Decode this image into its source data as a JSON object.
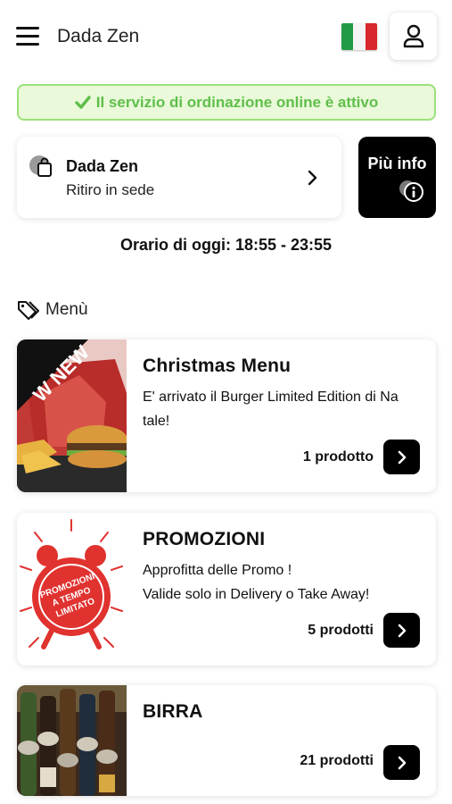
{
  "header": {
    "title": "Dada Zen",
    "menu_icon": "hamburger-menu-icon",
    "language_flag": "italy-flag",
    "user_icon": "user-icon"
  },
  "status_banner": {
    "text": "Il servizio di ordinazione online è attivo",
    "icon": "checkmark-icon",
    "color": "#5fbf4a",
    "background": "#e9f9d9"
  },
  "store": {
    "name": "Dada Zen",
    "mode": "Ritiro in sede",
    "icon": "shopping-bag-icon"
  },
  "info_button": {
    "label": "Più info",
    "icon": "info-icon"
  },
  "hours": "Orario di oggi: 18:55 - 23:55",
  "menu_section": {
    "label": "Menù",
    "icon": "tag-icon"
  },
  "categories": [
    {
      "title": "Christmas Menu",
      "description": "E' arrivato il Burger Limited Edition di Na tale!",
      "count": "1 prodotto",
      "badge": "NEW"
    },
    {
      "title": "PROMOZIONI",
      "description": "Approfitta delle Promo !\nValide solo in Delivery o Take Away!",
      "count": "5 prodotti",
      "image_text": "PROMOZIONI A TEMPO LIMITATO"
    },
    {
      "title": "BIRRA",
      "description": "",
      "count": "21 prodotti"
    }
  ]
}
